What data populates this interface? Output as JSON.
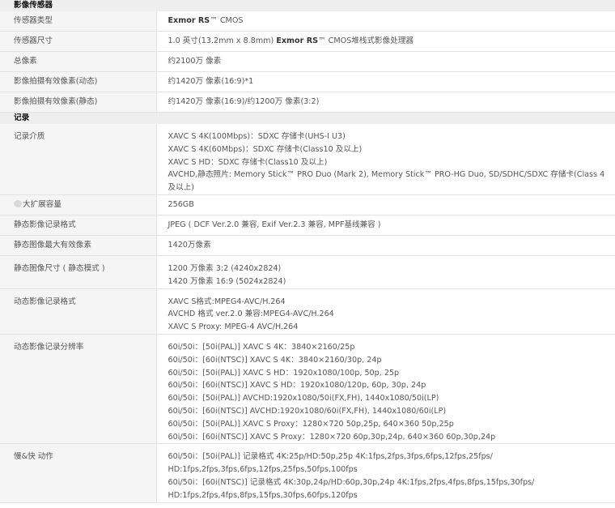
{
  "sections": {
    "sensor": "影像传感器",
    "recording": "记录"
  },
  "rows": {
    "sensor_type": {
      "label": "传感器类型",
      "value_bold": "Exmor RS",
      "value_suffix": "™ CMOS"
    },
    "sensor_size": {
      "label": "传感器尺寸",
      "value_prefix": "1.0 英寸(13.2mm x 8.8mm) ",
      "value_bold": "Exmor RS",
      "value_suffix": "™ CMOS堆栈式影像处理器"
    },
    "total_pixels": {
      "label": "总像素",
      "value": "约2100万 像素"
    },
    "effective_movie": {
      "label": "影像拍摄有效像素(动态)",
      "value": "约1420万 像素(16:9)*1"
    },
    "effective_still": {
      "label": "影像拍摄有效像素(静态)",
      "value": "约1420万 像素(16:9)/约1200万 像素(3:2)"
    },
    "media": {
      "label": "记录介质",
      "lines": [
        "XAVC S 4K(100Mbps)：SDXC 存储卡(UHS-I U3)",
        "XAVC S 4K(60Mbps)：SDXC 存储卡(Class10 及以上)",
        "XAVC S HD：SDXC 存储卡(Class10 及以上)",
        "AVCHD,静态照片: Memory Stick™ PRO Duo (Mark 2), Memory Stick™ PRO-HG Duo, SD/SDHC/SDXC 存储卡(Class 4 及以上)"
      ]
    },
    "max_capacity": {
      "label": "大扩展容量",
      "value": "256GB"
    },
    "still_format": {
      "label": "静态影像记录格式",
      "value": "JPEG ( DCF Ver.2.0 兼容, Exif Ver.2.3 兼容, MPF基线兼容 )"
    },
    "still_max_pixels": {
      "label": "静态图像最大有效像素",
      "value": "1420万像素"
    },
    "still_size": {
      "label": "静态图像尺寸 ( 静态模式 )",
      "lines": [
        "1200 万像素 3:2 (4240x2824)",
        "1420 万像素 16:9 (5024x2824)"
      ]
    },
    "movie_format": {
      "label": "动态影像记录格式",
      "lines": [
        "XAVC S格式:MPEG4-AVC/H.264",
        "AVCHD 格式 ver.2.0 兼容:MPEG4-AVC/H.264",
        "XAVC S Proxy: MPEG-4 AVC/H.264"
      ]
    },
    "movie_resolution": {
      "label": "动态影像记录分辨率",
      "lines": [
        "60i/50i：[50i(PAL)] XAVC S 4K：3840×2160/25p",
        "60i/50i：[60i(NTSC)] XAVC S 4K：3840×2160/30p, 24p",
        "60i/50i：[50i(PAL)] XAVC S HD：1920x1080/100p, 50p, 25p",
        "60i/50i：[60i(NTSC)] XAVC S HD：1920x1080/120p, 60p, 30p, 24p",
        "60i/50i：[50i(PAL)] AVCHD:1920x1080/50i(FX,FH), 1440x1080/50i(LP)",
        "60i/50i：[60i(NTSC)] AVCHD:1920x1080/60i(FX,FH), 1440x1080/60i(LP)",
        "60i/50i：[50i(PAL)] XAVC S Proxy：1280×720 50p,25p, 640×360 50p,25p",
        "60i/50i：[60i(NTSC)] XAVC S Proxy：1280×720 60p,30p,24p, 640×360 60p,30p,24p"
      ]
    },
    "slow_quick": {
      "label": "慢&快 动作",
      "lines": [
        "60i/50i：[50i(PAL)] 记录格式 4K:25p/HD:50p,25p 4K:1fps,2fps,3fps,6fps,12fps,25fps/",
        "HD:1fps,2fps,3fps,6fps,12fps,25fps,50fps,100fps",
        "60i/50i：[60i(NTSC)] 记录格式 4K:30p,24p/HD:60p,30p,24p 4K:1fps,2fps,4fps,8fps,15fps,30fps/",
        "HD:1fps,2fps,4fps,8fps,15fps,30fps,60fps,120fps"
      ]
    }
  }
}
